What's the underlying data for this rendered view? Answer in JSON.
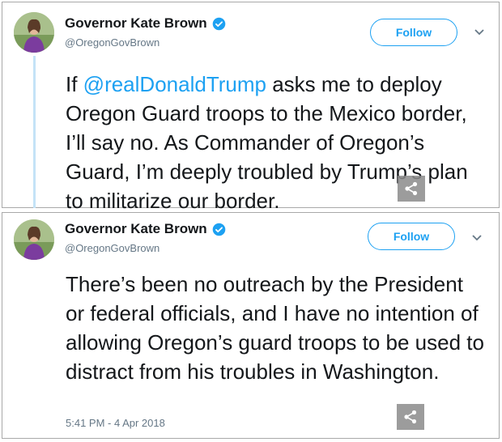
{
  "tweets": [
    {
      "author": {
        "name": "Governor Kate Brown",
        "handle": "@OregonGovBrown"
      },
      "follow_label": "Follow",
      "text_prefix": "If ",
      "mention": "@realDonaldTrump",
      "text_rest": " asks me to deploy Oregon Guard troops to the Mexico border, I’ll say no. As Commander of Oregon’s Guard, I’m deeply troubled by Trump’s plan to militarize our border."
    },
    {
      "author": {
        "name": "Governor Kate Brown",
        "handle": "@OregonGovBrown"
      },
      "follow_label": "Follow",
      "text": "There’s been no outreach by the President or federal officials, and I have no intention of allowing Oregon’s guard troops to be used to distract from his troubles in Washington.",
      "timestamp": "5:41 PM - 4 Apr 2018"
    }
  ],
  "colors": {
    "accent": "#1da1f2",
    "text": "#14171a",
    "muted": "#657786"
  },
  "icons": {
    "verified": "verified-badge-icon",
    "more": "chevron-down-icon",
    "share": "share-icon"
  }
}
